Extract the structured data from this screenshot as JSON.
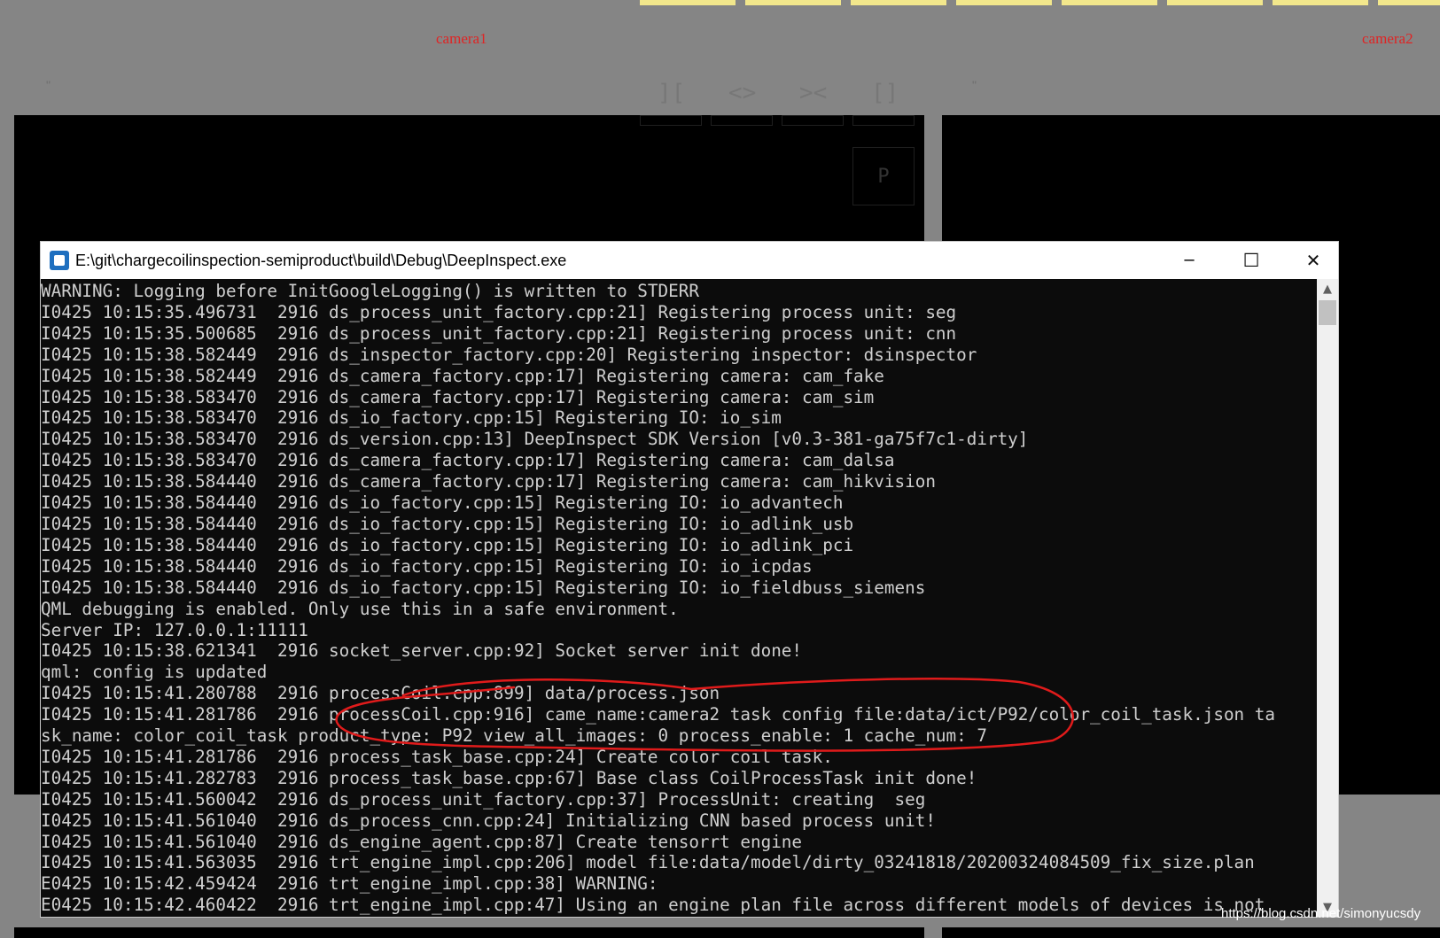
{
  "background": {
    "camera1_label": "camera1",
    "camera2_label": "camera2",
    "ticks": [
      "\"",
      "\""
    ],
    "controls": [
      "][",
      "<>",
      "><",
      "[]"
    ],
    "p_button": "P"
  },
  "console": {
    "title": "E:\\git\\chargecoilinspection-semiproduct\\build\\Debug\\DeepInspect.exe",
    "icons": {
      "app": "console-app-icon",
      "minimize": "minimize-icon",
      "maximize": "maximize-icon",
      "close": "close-icon"
    },
    "glyphs": {
      "minimize": "─",
      "maximize": "☐",
      "close": "✕",
      "up": "▲",
      "down": "▼"
    },
    "lines": [
      "WARNING: Logging before InitGoogleLogging() is written to STDERR",
      "I0425 10:15:35.496731  2916 ds_process_unit_factory.cpp:21] Registering process unit: seg",
      "I0425 10:15:35.500685  2916 ds_process_unit_factory.cpp:21] Registering process unit: cnn",
      "I0425 10:15:38.582449  2916 ds_inspector_factory.cpp:20] Registering inspector: dsinspector",
      "I0425 10:15:38.582449  2916 ds_camera_factory.cpp:17] Registering camera: cam_fake",
      "I0425 10:15:38.583470  2916 ds_camera_factory.cpp:17] Registering camera: cam_sim",
      "I0425 10:15:38.583470  2916 ds_io_factory.cpp:15] Registering IO: io_sim",
      "I0425 10:15:38.583470  2916 ds_version.cpp:13] DeepInspect SDK Version [v0.3-381-ga75f7c1-dirty]",
      "I0425 10:15:38.583470  2916 ds_camera_factory.cpp:17] Registering camera: cam_dalsa",
      "I0425 10:15:38.584440  2916 ds_camera_factory.cpp:17] Registering camera: cam_hikvision",
      "I0425 10:15:38.584440  2916 ds_io_factory.cpp:15] Registering IO: io_advantech",
      "I0425 10:15:38.584440  2916 ds_io_factory.cpp:15] Registering IO: io_adlink_usb",
      "I0425 10:15:38.584440  2916 ds_io_factory.cpp:15] Registering IO: io_adlink_pci",
      "I0425 10:15:38.584440  2916 ds_io_factory.cpp:15] Registering IO: io_icpdas",
      "I0425 10:15:38.584440  2916 ds_io_factory.cpp:15] Registering IO: io_fieldbuss_siemens",
      "QML debugging is enabled. Only use this in a safe environment.",
      "Server IP: 127.0.0.1:11111",
      "I0425 10:15:38.621341  2916 socket_server.cpp:92] Socket server init done!",
      "qml: config is updated",
      "I0425 10:15:41.280788  2916 processCoil.cpp:899] data/process.json",
      "I0425 10:15:41.281786  2916 processCoil.cpp:916] came_name:camera2 task config file:data/ict/P92/color_coil_task.json ta",
      "sk_name: color_coil_task product_type: P92 view_all_images: 0 process_enable: 1 cache_num: 7",
      "I0425 10:15:41.281786  2916 process_task_base.cpp:24] Create color coil task.",
      "I0425 10:15:41.282783  2916 process_task_base.cpp:67] Base class CoilProcessTask init done!",
      "I0425 10:15:41.560042  2916 ds_process_unit_factory.cpp:37] ProcessUnit: creating  seg",
      "I0425 10:15:41.561040  2916 ds_process_cnn.cpp:24] Initializing CNN based process unit!",
      "I0425 10:15:41.561040  2916 ds_engine_agent.cpp:87] Create tensorrt engine",
      "I0425 10:15:41.563035  2916 trt_engine_impl.cpp:206] model file:data/model/dirty_03241818/20200324084509_fix_size.plan",
      "E0425 10:15:42.459424  2916 trt_engine_impl.cpp:38] WARNING:",
      "E0425 10:15:42.460422  2916 trt_engine_impl.cpp:47] Using an engine plan file across different models of devices is not"
    ]
  },
  "watermark": "https://blog.csdn.net/simonyucsdy",
  "colors": {
    "background": "#858585",
    "console_bg": "#0c0c0c",
    "console_text": "#cfcfcf",
    "label_red": "#e02424",
    "yellow_button": "#f2e78c",
    "annotation_red": "#e01b1b"
  }
}
